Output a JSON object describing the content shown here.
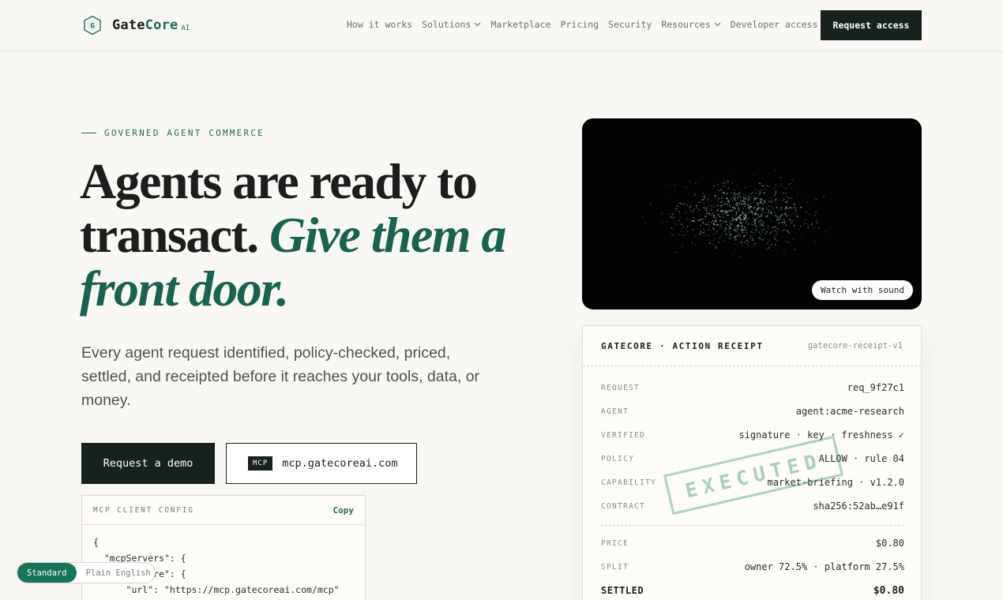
{
  "brand": {
    "name_part1": "Gate",
    "name_part2": "Core",
    "suffix": "AI"
  },
  "nav": {
    "items": [
      {
        "label": "How it works",
        "has_dropdown": false
      },
      {
        "label": "Solutions",
        "has_dropdown": true
      },
      {
        "label": "Marketplace",
        "has_dropdown": false
      },
      {
        "label": "Pricing",
        "has_dropdown": false
      },
      {
        "label": "Security",
        "has_dropdown": false
      },
      {
        "label": "Resources",
        "has_dropdown": true
      },
      {
        "label": "Developer access",
        "has_dropdown": false
      }
    ],
    "cta": "Request access"
  },
  "hero": {
    "eyebrow": "GOVERNED AGENT COMMERCE",
    "headline_plain_1": "Agents are ready to",
    "headline_plain_2": "transact.",
    "headline_em_1": "Give them a",
    "headline_em_2": "front door.",
    "subtitle": "Every agent request identified, policy-checked, priced, settled, and receipted before it reaches your tools, data, or money.",
    "primary_button": "Request a demo",
    "mcp_tag": "MCP",
    "mcp_url": "mcp.gatecoreai.com"
  },
  "config": {
    "title": "MCP CLIENT CONFIG",
    "copy_label": "Copy",
    "code": "{\n  \"mcpServers\": {\n    \"gatecore\": {\n      \"url\": \"https://mcp.gatecoreai.com/mcp\"\n    }"
  },
  "mode_toggle": {
    "active": "Standard",
    "inactive": "Plain English"
  },
  "video": {
    "button": "Watch with sound"
  },
  "receipt": {
    "title": "GATECORE · ACTION RECEIPT",
    "version": "gatecore-receipt-v1",
    "rows": [
      {
        "label": "REQUEST",
        "value": "req_9f27c1"
      },
      {
        "label": "AGENT",
        "value": "agent:acme-research"
      },
      {
        "label": "VERIFIED",
        "value": "signature · key · freshness ✓"
      },
      {
        "label": "POLICY",
        "value": "ALLOW · rule 04"
      },
      {
        "label": "CAPABILITY",
        "value": "market-briefing · v1.2.0"
      },
      {
        "label": "CONTRACT",
        "value": "sha256:52ab…e91f"
      }
    ],
    "pricing": [
      {
        "label": "PRICE",
        "value": "$0.80"
      },
      {
        "label": "SPLIT",
        "value": "owner 72.5% · platform 27.5%"
      }
    ],
    "total": {
      "label": "SETTLED",
      "value": "$0.80"
    },
    "stamp": "EXECUTED"
  },
  "colors": {
    "accent": "#1b6b55",
    "dark": "#17211d",
    "background": "#faf8f4"
  }
}
